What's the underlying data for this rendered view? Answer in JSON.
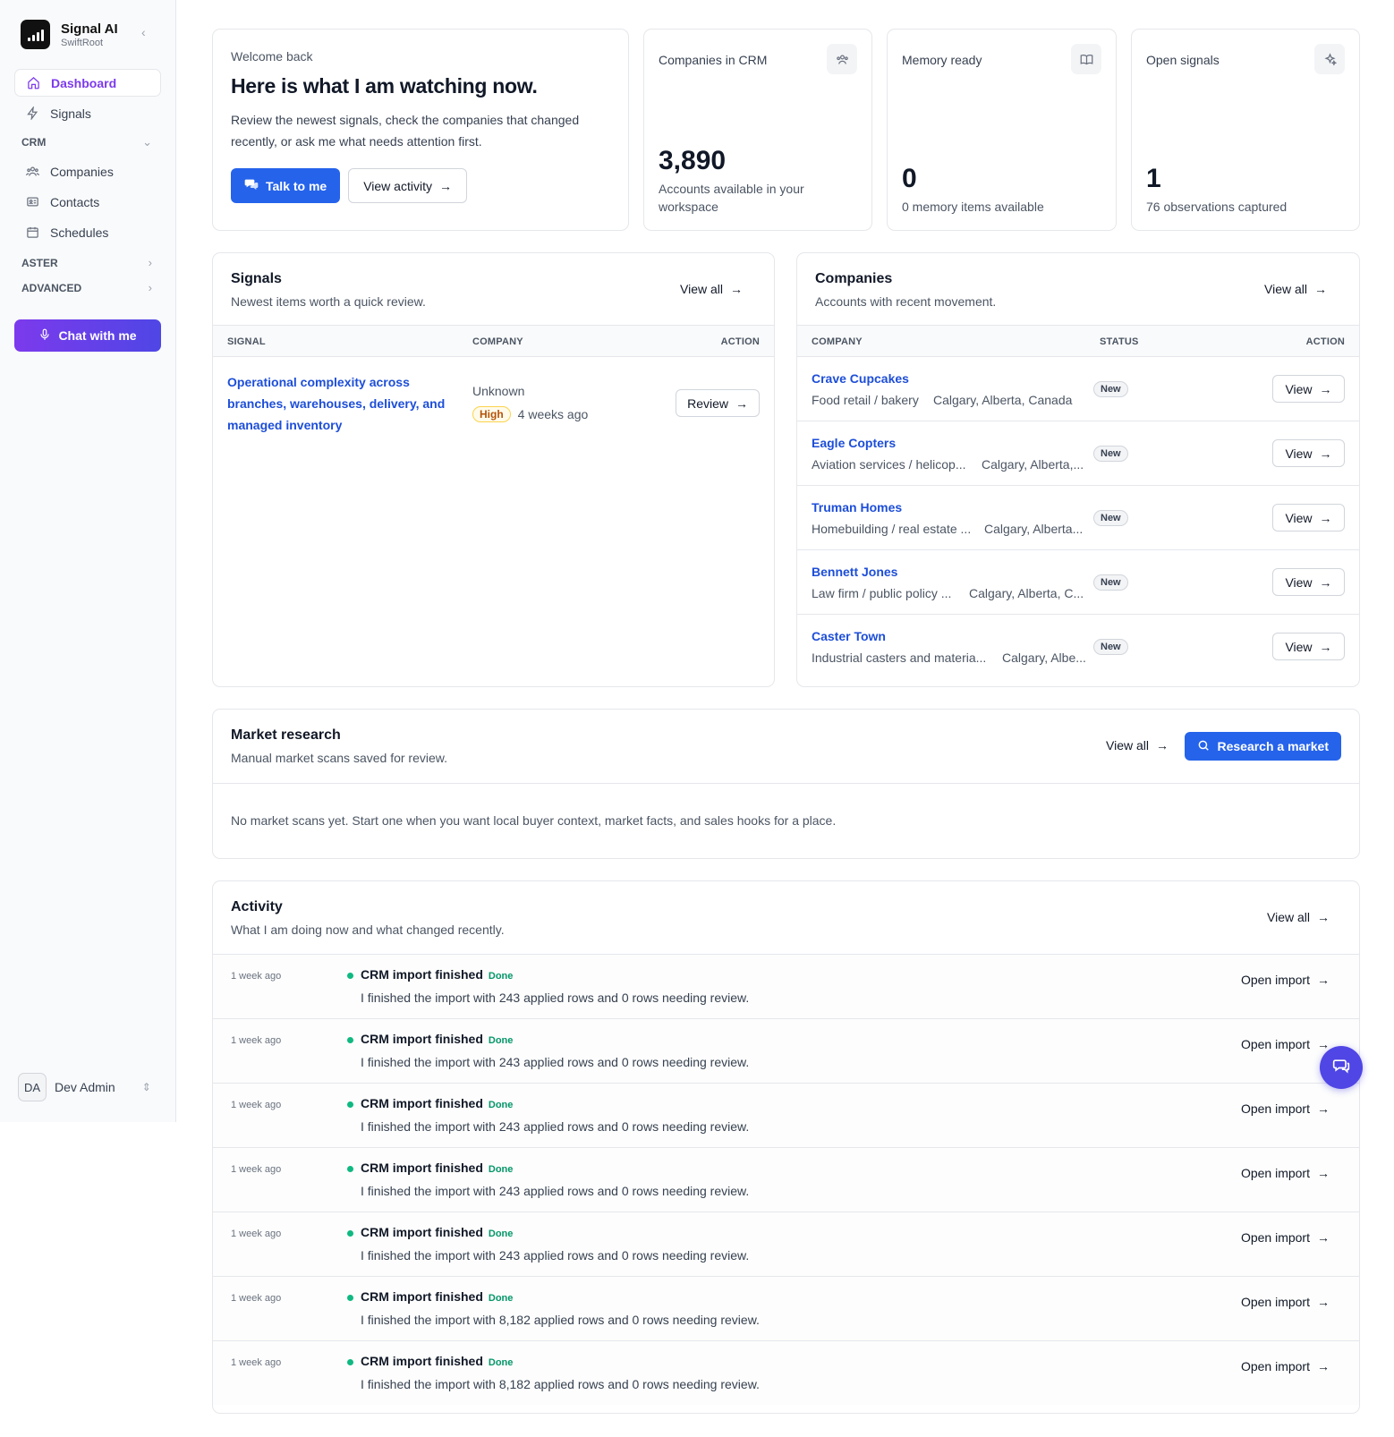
{
  "brand": {
    "name": "Signal AI",
    "workspace": "SwiftRoot"
  },
  "nav": {
    "dashboard": "Dashboard",
    "signals": "Signals",
    "crm_group": "CRM",
    "companies": "Companies",
    "contacts": "Contacts",
    "schedules": "Schedules",
    "aster_group": "ASTER",
    "advanced_group": "ADVANCED",
    "chat_button": "Chat with me"
  },
  "user": {
    "initials": "DA",
    "name": "Dev Admin"
  },
  "welcome": {
    "kicker": "Welcome back",
    "title": "Here is what I am watching now.",
    "description": "Review the newest signals, check the companies that changed recently, or ask me what needs attention first.",
    "talk_button": "Talk to me",
    "activity_button": "View activity"
  },
  "stats": {
    "companies": {
      "label": "Companies in CRM",
      "value": "3,890",
      "sub": "Accounts available in your workspace"
    },
    "memory": {
      "label": "Memory ready",
      "value": "0",
      "sub": "0 memory items available"
    },
    "signals": {
      "label": "Open signals",
      "value": "1",
      "sub": "76 observations captured"
    }
  },
  "signals_card": {
    "title": "Signals",
    "subtitle": "Newest items worth a quick review.",
    "view_all": "View all",
    "columns": {
      "signal": "SIGNAL",
      "company": "COMPANY",
      "action": "ACTION"
    },
    "rows": [
      {
        "signal": "Operational complexity across branches, warehouses, delivery, and managed inventory",
        "company": "Unknown",
        "priority": "High",
        "time": "4 weeks ago",
        "action": "Review"
      }
    ]
  },
  "companies_card": {
    "title": "Companies",
    "subtitle": "Accounts with recent movement.",
    "view_all": "View all",
    "columns": {
      "company": "COMPANY",
      "status": "STATUS",
      "action": "ACTION"
    },
    "rows": [
      {
        "name": "Crave Cupcakes",
        "industry": "Food retail / bakery",
        "location": "Calgary, Alberta, Canada",
        "status": "New",
        "action": "View"
      },
      {
        "name": "Eagle Copters",
        "industry": "Aviation services / helicop...",
        "location": "Calgary, Alberta,...",
        "status": "New",
        "action": "View"
      },
      {
        "name": "Truman Homes",
        "industry": "Homebuilding / real estate ...",
        "location": "Calgary, Alberta...",
        "status": "New",
        "action": "View"
      },
      {
        "name": "Bennett Jones",
        "industry": "Law firm / public policy ...",
        "location": "Calgary, Alberta, C...",
        "status": "New",
        "action": "View"
      },
      {
        "name": "Caster Town",
        "industry": "Industrial casters and materia...",
        "location": "Calgary, Albe...",
        "status": "New",
        "action": "View"
      }
    ]
  },
  "market": {
    "title": "Market research",
    "subtitle": "Manual market scans saved for review.",
    "view_all": "View all",
    "research_button": "Research a market",
    "empty": "No market scans yet. Start one when you want local buyer context, market facts, and sales hooks for a place."
  },
  "activity": {
    "title": "Activity",
    "subtitle": "What I am doing now and what changed recently.",
    "view_all": "View all",
    "rows": [
      {
        "time": "1 week ago",
        "title": "CRM import finished",
        "status": "Done",
        "desc": "I finished the import with 243 applied rows and 0 rows needing review.",
        "action": "Open import"
      },
      {
        "time": "1 week ago",
        "title": "CRM import finished",
        "status": "Done",
        "desc": "I finished the import with 243 applied rows and 0 rows needing review.",
        "action": "Open import"
      },
      {
        "time": "1 week ago",
        "title": "CRM import finished",
        "status": "Done",
        "desc": "I finished the import with 243 applied rows and 0 rows needing review.",
        "action": "Open import"
      },
      {
        "time": "1 week ago",
        "title": "CRM import finished",
        "status": "Done",
        "desc": "I finished the import with 243 applied rows and 0 rows needing review.",
        "action": "Open import"
      },
      {
        "time": "1 week ago",
        "title": "CRM import finished",
        "status": "Done",
        "desc": "I finished the import with 243 applied rows and 0 rows needing review.",
        "action": "Open import"
      },
      {
        "time": "1 week ago",
        "title": "CRM import finished",
        "status": "Done",
        "desc": "I finished the import with 8,182 applied rows and 0 rows needing review.",
        "action": "Open import"
      },
      {
        "time": "1 week ago",
        "title": "CRM import finished",
        "status": "Done",
        "desc": "I finished the import with 8,182 applied rows and 0 rows needing review.",
        "action": "Open import"
      }
    ]
  }
}
